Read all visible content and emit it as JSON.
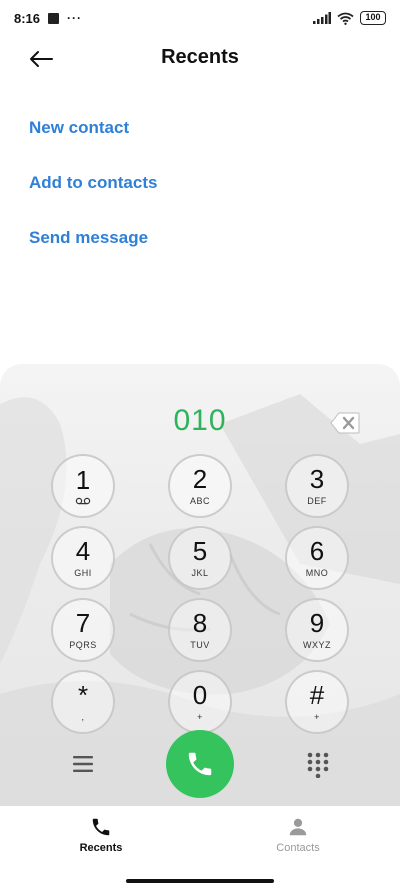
{
  "status_bar": {
    "time": "8:16",
    "overflow_dots": "···",
    "battery": "100"
  },
  "header": {
    "title": "Recents"
  },
  "actions": [
    {
      "label": "New contact"
    },
    {
      "label": "Add to contacts"
    },
    {
      "label": "Send message"
    }
  ],
  "dialer": {
    "number": "010",
    "keys": [
      {
        "digit": "1",
        "letters": ""
      },
      {
        "digit": "2",
        "letters": "ABC"
      },
      {
        "digit": "3",
        "letters": "DEF"
      },
      {
        "digit": "4",
        "letters": "GHI"
      },
      {
        "digit": "5",
        "letters": "JKL"
      },
      {
        "digit": "6",
        "letters": "MNO"
      },
      {
        "digit": "7",
        "letters": "PQRS"
      },
      {
        "digit": "8",
        "letters": "TUV"
      },
      {
        "digit": "9",
        "letters": "WXYZ"
      },
      {
        "digit": "*",
        "letters": ","
      },
      {
        "digit": "0",
        "letters": "+"
      },
      {
        "digit": "#",
        "letters": "+"
      }
    ]
  },
  "bottom_nav": {
    "recents": "Recents",
    "contacts": "Contacts"
  },
  "colors": {
    "accent_link": "#2f80d8",
    "number_green": "#2fb35a",
    "call_green": "#35c35e"
  }
}
